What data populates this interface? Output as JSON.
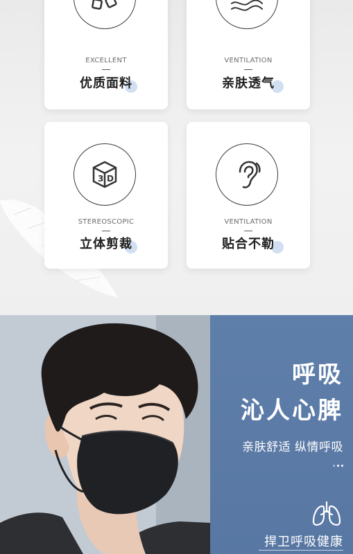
{
  "features": [
    {
      "en": "EXCELLENT",
      "zh": "优质面料",
      "icon": "fabric-cubes-icon"
    },
    {
      "en": "VENTILATION",
      "zh": "亲肤透气",
      "icon": "airflow-waves-icon"
    },
    {
      "en": "STEREOSCOPIC",
      "zh": "立体剪裁",
      "icon": "3d-cube-icon"
    },
    {
      "en": "VENTILATION",
      "zh": "贴合不勒",
      "icon": "ear-icon"
    }
  ],
  "banner": {
    "title_line1": "呼吸",
    "title_line2": "沁人心脾",
    "subtitle": "亲肤舒适 纵情呼吸",
    "footer": "捍卫呼吸健康",
    "footer_icon": "lungs-icon"
  },
  "colors": {
    "panel": "#5b7aa6",
    "accent_dot": "#c9d9ee",
    "card": "#ffffff"
  }
}
